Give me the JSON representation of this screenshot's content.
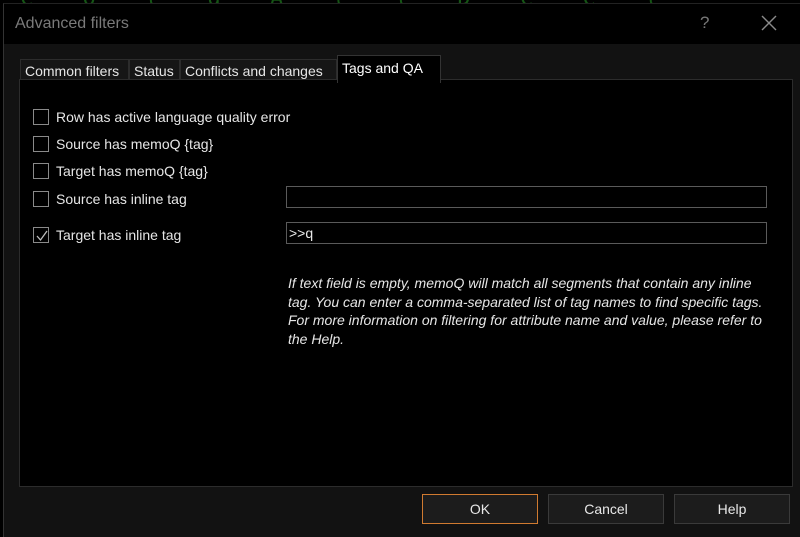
{
  "window": {
    "title": "Advanced filters",
    "help_icon": "question-mark-icon",
    "close_icon": "close-icon"
  },
  "tabs": [
    {
      "label": "Common filters",
      "active": false
    },
    {
      "label": "Status",
      "active": false
    },
    {
      "label": "Conflicts and changes",
      "active": false
    },
    {
      "label": "Tags and QA",
      "active": true
    }
  ],
  "options": [
    {
      "label": "Row has active language quality error",
      "checked": false
    },
    {
      "label": "Source has memoQ {tag}",
      "checked": false
    },
    {
      "label": "Target has memoQ {tag}",
      "checked": false
    },
    {
      "label": "Source has inline tag",
      "checked": false,
      "field_value": ""
    },
    {
      "label": "Target has inline tag",
      "checked": true,
      "field_value": ">>q"
    }
  ],
  "info": {
    "paragraph1": "If text field is empty, memoQ will match all segments that contain any inline tag. You can enter a comma-separated list of tag names to find specific tags.",
    "paragraph2": "For more information on filtering for attribute name and value, please refer to the Help."
  },
  "buttons": {
    "ok": "OK",
    "cancel": "Cancel",
    "help": "Help"
  },
  "colors": {
    "default_button_border": "#d07a30",
    "background_text": "#1e7a1e"
  }
}
